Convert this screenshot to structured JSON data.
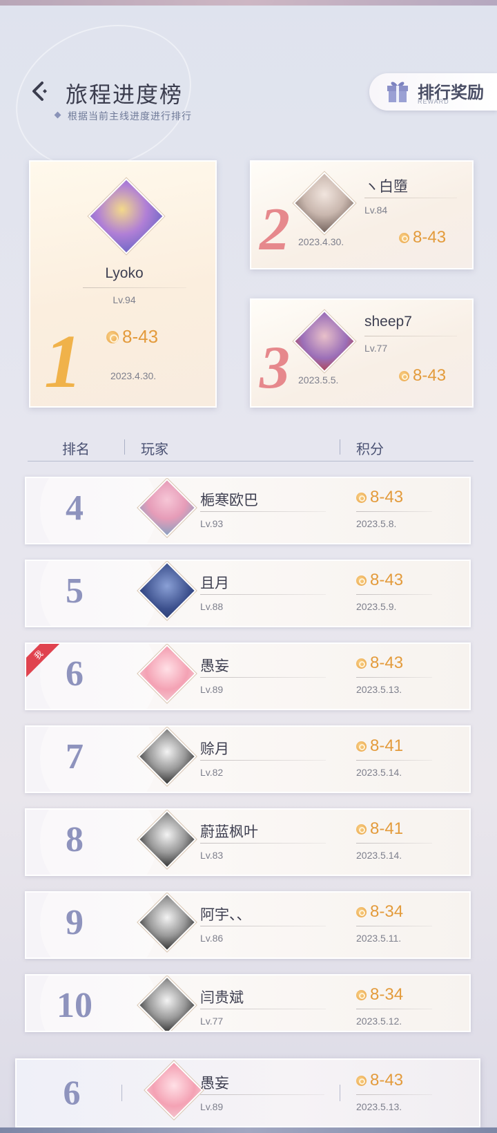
{
  "header": {
    "title": "旅程进度榜",
    "subtitle": "根据当前主线进度进行排行",
    "reward_button": {
      "label": "排行奖励",
      "sub_label": "REWARD"
    }
  },
  "podium": {
    "first": {
      "rank": "1",
      "name": "Lyoko",
      "level": "Lv.94",
      "score": "8-43",
      "date": "2023.4.30.",
      "avatar_icon": "avatar-purple-hair-girl-icon"
    },
    "second": {
      "rank": "2",
      "name": "ヽ白墮",
      "level": "Lv.84",
      "score": "8-43",
      "date": "2023.4.30.",
      "avatar_icon": "avatar-silver-hair-girl-icon"
    },
    "third": {
      "rank": "3",
      "name": "sheep7",
      "level": "Lv.77",
      "score": "8-43",
      "date": "2023.5.5.",
      "avatar_icon": "avatar-christmas-girl-icon"
    }
  },
  "list_header": {
    "rank": "排名",
    "player": "玩家",
    "score": "积分"
  },
  "rows": [
    {
      "rank": "4",
      "name": "梔寒欧巴",
      "level": "Lv.93",
      "score": "8-43",
      "date": "2023.5.8.",
      "is_me": false,
      "avatar": "av-pink"
    },
    {
      "rank": "5",
      "name": "且月",
      "level": "Lv.88",
      "score": "8-43",
      "date": "2023.5.9.",
      "is_me": false,
      "avatar": "av-dark"
    },
    {
      "rank": "6",
      "name": "愚妄",
      "level": "Lv.89",
      "score": "8-43",
      "date": "2023.5.13.",
      "is_me": true,
      "avatar": "av-pinkgirl"
    },
    {
      "rank": "7",
      "name": "赊月",
      "level": "Lv.82",
      "score": "8-41",
      "date": "2023.5.14.",
      "is_me": false,
      "avatar": "av-bw"
    },
    {
      "rank": "8",
      "name": "蔚蓝枫叶",
      "level": "Lv.83",
      "score": "8-41",
      "date": "2023.5.14.",
      "is_me": false,
      "avatar": "av-bw"
    },
    {
      "rank": "9",
      "name": "阿宇、、",
      "level": "Lv.86",
      "score": "8-34",
      "date": "2023.5.11.",
      "is_me": false,
      "avatar": "av-bw"
    },
    {
      "rank": "10",
      "name": "闫贵斌",
      "level": "Lv.77",
      "score": "8-34",
      "date": "2023.5.12.",
      "is_me": false,
      "avatar": "av-bw"
    }
  ],
  "me_tag": "我",
  "my_rank": {
    "rank": "6",
    "name": "愚妄",
    "level": "Lv.89",
    "score": "8-43",
    "date": "2023.5.13."
  },
  "colors": {
    "accent_gold": "#e39b3c",
    "rank_blue": "#8e93bd",
    "rank_pink": "#e6888c",
    "rank_first": "#f0b24a",
    "me_tag": "#e0434f"
  }
}
